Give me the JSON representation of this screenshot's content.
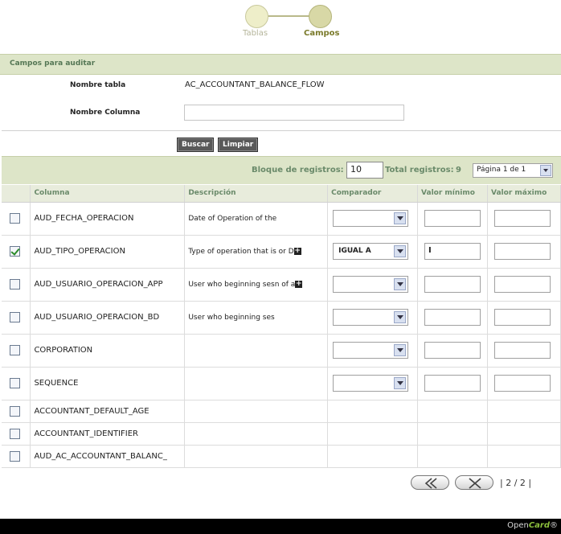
{
  "wizard": {
    "steps": [
      {
        "label": "Tablas"
      },
      {
        "label": "Campos"
      }
    ]
  },
  "section": {
    "title": "Campos para auditar"
  },
  "form": {
    "table_name_label": "Nombre tabla",
    "table_name_value": "AC_ACCOUNTANT_BALANCE_FLOW",
    "column_name_label": "Nombre Columna",
    "column_name_value": ""
  },
  "buttons": {
    "search": "Buscar",
    "clear": "Limpiar"
  },
  "records": {
    "block_label": "Bloque de registros:",
    "block_value": "10",
    "total_label": "Total registros:",
    "total_value": "9",
    "page_select": "Página 1 de 1"
  },
  "table": {
    "headers": [
      "Columna",
      "Descripción",
      "Comparador",
      "Valor mínimo",
      "Valor máximo"
    ],
    "rows": [
      {
        "checked": false,
        "column": "AUD_FECHA_OPERACION",
        "description": "Date of Operation of the",
        "expand": false,
        "comparator": "",
        "min": "",
        "max": "",
        "editable": true
      },
      {
        "checked": true,
        "column": "AUD_TIPO_OPERACION",
        "description": "Type of operation that is or D",
        "expand": true,
        "comparator": "IGUAL A",
        "min": "I",
        "max": "",
        "editable": true
      },
      {
        "checked": false,
        "column": "AUD_USUARIO_OPERACION_APP",
        "description": "User who beginning sesn of a",
        "expand": true,
        "comparator": "",
        "min": "",
        "max": "",
        "editable": true
      },
      {
        "checked": false,
        "column": "AUD_USUARIO_OPERACION_BD",
        "description": "User who beginning ses",
        "expand": false,
        "comparator": "",
        "min": "",
        "max": "",
        "editable": true
      },
      {
        "checked": false,
        "column": "CORPORATION",
        "description": "",
        "expand": false,
        "comparator": "",
        "min": "",
        "max": "",
        "editable": true
      },
      {
        "checked": false,
        "column": "SEQUENCE",
        "description": "",
        "expand": false,
        "comparator": "",
        "min": "",
        "max": "",
        "editable": true
      },
      {
        "checked": false,
        "column": "ACCOUNTANT_DEFAULT_AGE",
        "description": "",
        "expand": false,
        "comparator": "",
        "min": "",
        "max": "",
        "editable": false
      },
      {
        "checked": false,
        "column": "ACCOUNTANT_IDENTIFIER",
        "description": "",
        "expand": false,
        "comparator": "",
        "min": "",
        "max": "",
        "editable": false
      },
      {
        "checked": false,
        "column": "AUD_AC_ACCOUNTANT_BALANC_",
        "description": "",
        "expand": false,
        "comparator": "",
        "min": "",
        "max": "",
        "editable": false
      }
    ]
  },
  "pager": {
    "text": "| 2 / 2 |"
  },
  "footer": {
    "brand_prefix": "Open",
    "brand_accent": "Card",
    "brand_suffix": "®"
  },
  "icons": {
    "prev": "double-chevron-left-icon",
    "close": "x-icon",
    "expand": "plus-icon",
    "dropdown": "chevron-down-icon"
  }
}
